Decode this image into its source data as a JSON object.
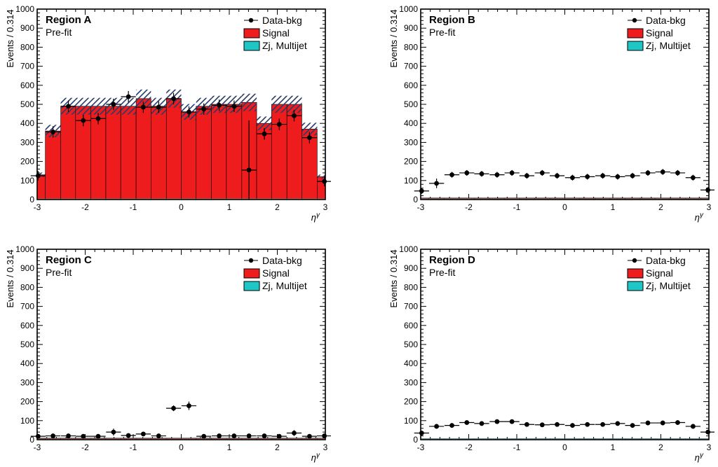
{
  "chart_data": [
    {
      "region": "Region A",
      "prefit": "Pre-fit",
      "ylabel": "Events / 0.314",
      "xlabel": "η^γ",
      "xlim": [
        -3,
        3
      ],
      "ylim": [
        0,
        1000
      ],
      "xticks": [
        -3,
        -2,
        -1,
        0,
        1,
        2,
        3
      ],
      "yticks": [
        0,
        100,
        200,
        300,
        400,
        500,
        600,
        700,
        800,
        900,
        1000
      ],
      "legend": {
        "data": "Data-bkg",
        "signal": "Signal",
        "zj": "Zj, Multijet"
      },
      "type": "bar",
      "bin_edges": [
        -3.14,
        -2.83,
        -2.51,
        -2.2,
        -1.88,
        -1.57,
        -1.26,
        -0.94,
        -0.63,
        -0.31,
        0,
        0.31,
        0.63,
        0.94,
        1.26,
        1.57,
        1.88,
        2.2,
        2.51,
        2.83,
        3.14
      ],
      "signal_values": [
        130,
        360,
        490,
        490,
        490,
        490,
        490,
        530,
        490,
        530,
        460,
        490,
        500,
        500,
        510,
        400,
        500,
        500,
        370,
        120
      ],
      "data_points": {
        "x": [
          -2.98,
          -2.67,
          -2.35,
          -2.04,
          -1.73,
          -1.41,
          -1.1,
          -0.79,
          -0.47,
          -0.16,
          0.16,
          0.47,
          0.79,
          1.1,
          1.41,
          1.73,
          2.04,
          2.35,
          2.67,
          2.98
        ],
        "y": [
          125,
          355,
          490,
          415,
          425,
          500,
          540,
          485,
          485,
          530,
          460,
          475,
          495,
          490,
          155,
          345,
          395,
          440,
          325,
          95
        ],
        "yerr": [
          25,
          30,
          30,
          30,
          30,
          30,
          30,
          30,
          30,
          30,
          30,
          30,
          30,
          30,
          260,
          30,
          30,
          30,
          30,
          25
        ]
      }
    },
    {
      "region": "Region B",
      "prefit": "Pre-fit",
      "ylabel": "Events / 0.314",
      "xlabel": "η^γ",
      "xlim": [
        -3,
        3
      ],
      "ylim": [
        0,
        1000
      ],
      "xticks": [
        -3,
        -2,
        -1,
        0,
        1,
        2,
        3
      ],
      "yticks": [
        0,
        100,
        200,
        300,
        400,
        500,
        600,
        700,
        800,
        900,
        1000
      ],
      "legend": {
        "data": "Data-bkg",
        "signal": "Signal",
        "zj": "Zj, Multijet"
      },
      "type": "bar",
      "bin_edges": [
        -3.14,
        -2.83,
        -2.51,
        -2.2,
        -1.88,
        -1.57,
        -1.26,
        -0.94,
        -0.63,
        -0.31,
        0,
        0.31,
        0.63,
        0.94,
        1.26,
        1.57,
        1.88,
        2.2,
        2.51,
        2.83,
        3.14
      ],
      "signal_values": [
        8,
        8,
        8,
        8,
        8,
        8,
        8,
        8,
        8,
        8,
        8,
        8,
        8,
        8,
        8,
        8,
        8,
        8,
        8,
        8
      ],
      "data_points": {
        "x": [
          -2.98,
          -2.67,
          -2.35,
          -2.04,
          -0.79,
          -0.47,
          -0.16,
          0.16,
          0.47,
          0.79,
          1.1,
          1.41,
          1.73,
          2.04,
          2.35,
          2.67,
          2.98,
          -1.73,
          -1.41,
          -1.1
        ],
        "y": [
          45,
          85,
          130,
          140,
          125,
          140,
          125,
          115,
          120,
          125,
          120,
          125,
          140,
          145,
          140,
          115,
          50,
          135,
          130,
          140
        ],
        "yerr": [
          15,
          25,
          15,
          15,
          15,
          15,
          15,
          15,
          15,
          15,
          15,
          15,
          15,
          15,
          15,
          15,
          15,
          15,
          15,
          15
        ]
      }
    },
    {
      "region": "Region C",
      "prefit": "Pre-fit",
      "ylabel": "Events / 0.314",
      "xlabel": "η^γ",
      "xlim": [
        -3,
        3
      ],
      "ylim": [
        0,
        1000
      ],
      "xticks": [
        -3,
        -2,
        -1,
        0,
        1,
        2,
        3
      ],
      "yticks": [
        0,
        100,
        200,
        300,
        400,
        500,
        600,
        700,
        800,
        900,
        1000
      ],
      "legend": {
        "data": "Data-bkg",
        "signal": "Signal",
        "zj": "Zj, Multijet"
      },
      "type": "bar",
      "bin_edges": [
        -3.14,
        -2.83,
        -2.51,
        -2.2,
        -1.88,
        -1.57,
        -1.26,
        -0.94,
        -0.63,
        -0.31,
        0,
        0.31,
        0.63,
        0.94,
        1.26,
        1.57,
        1.88,
        2.2,
        2.51,
        2.83,
        3.14
      ],
      "signal_values": [
        8,
        8,
        8,
        8,
        8,
        8,
        8,
        8,
        8,
        8,
        8,
        8,
        8,
        8,
        8,
        8,
        8,
        8,
        8,
        8
      ],
      "data_points": {
        "x": [
          -2.98,
          -2.67,
          -2.35,
          -2.04,
          -1.73,
          -1.41,
          -1.1,
          -0.79,
          -0.47,
          -0.16,
          0.16,
          0.47,
          0.79,
          1.1,
          1.41,
          1.73,
          2.04,
          2.35,
          2.67,
          2.98
        ],
        "y": [
          18,
          20,
          20,
          18,
          18,
          40,
          22,
          30,
          20,
          165,
          178,
          18,
          20,
          20,
          20,
          20,
          18,
          35,
          18,
          20
        ],
        "yerr": [
          10,
          10,
          10,
          10,
          10,
          18,
          10,
          12,
          10,
          15,
          22,
          10,
          10,
          10,
          10,
          10,
          10,
          15,
          10,
          10
        ]
      }
    },
    {
      "region": "Region D",
      "prefit": "Pre-fit",
      "ylabel": "Events / 0.314",
      "xlabel": "η^γ",
      "xlim": [
        -3,
        3
      ],
      "ylim": [
        0,
        1000
      ],
      "xticks": [
        -3,
        -2,
        -1,
        0,
        1,
        2,
        3
      ],
      "yticks": [
        0,
        100,
        200,
        300,
        400,
        500,
        600,
        700,
        800,
        900,
        1000
      ],
      "legend": {
        "data": "Data-bkg",
        "signal": "Signal",
        "zj": "Zj, Multijet"
      },
      "type": "bar",
      "bin_edges": [
        -3.14,
        -2.83,
        -2.51,
        -2.2,
        -1.88,
        -1.57,
        -1.26,
        -0.94,
        -0.63,
        -0.31,
        0,
        0.31,
        0.63,
        0.94,
        1.26,
        1.57,
        1.88,
        2.2,
        2.51,
        2.83,
        3.14
      ],
      "signal_values": [
        5,
        5,
        5,
        5,
        5,
        5,
        5,
        5,
        5,
        5,
        5,
        5,
        5,
        5,
        5,
        5,
        5,
        5,
        5,
        5
      ],
      "data_points": {
        "x": [
          -2.98,
          -2.67,
          -2.35,
          -2.04,
          -1.73,
          -1.41,
          -1.1,
          -0.79,
          -0.47,
          -0.16,
          0.16,
          0.47,
          0.79,
          1.1,
          1.41,
          1.73,
          2.04,
          2.35,
          2.67,
          2.98
        ],
        "y": [
          35,
          70,
          75,
          90,
          85,
          95,
          95,
          80,
          78,
          80,
          75,
          80,
          80,
          85,
          75,
          88,
          88,
          90,
          70,
          40
        ],
        "yerr": [
          12,
          12,
          12,
          12,
          12,
          12,
          12,
          12,
          12,
          12,
          12,
          12,
          12,
          12,
          12,
          12,
          12,
          12,
          12,
          12
        ]
      }
    }
  ]
}
